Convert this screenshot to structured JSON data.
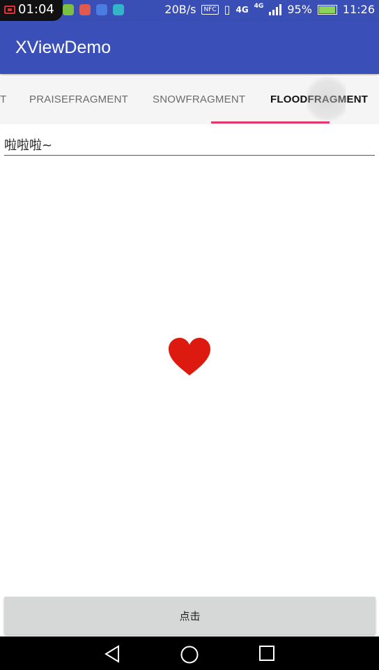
{
  "status_bar": {
    "recording_time": "01:04",
    "net_speed": "20B/s",
    "nfc": "NFC",
    "network": "4G",
    "network2": "4G",
    "battery": "95%",
    "clock": "11:26"
  },
  "app_bar": {
    "title": "XViewDemo"
  },
  "tabs": {
    "items": [
      {
        "label": "T"
      },
      {
        "label": "PRAISEFRAGMENT"
      },
      {
        "label": "SNOWFRAGMENT"
      },
      {
        "label": "FLOODFRAGMENT"
      }
    ],
    "active_index": 3
  },
  "input": {
    "value": "啦啦啦~"
  },
  "heart": {
    "icon": "heart-icon",
    "color": "#dd1a0f"
  },
  "button": {
    "label": "点击"
  },
  "nav_bar": {
    "back": "back-icon",
    "home": "home-icon",
    "recents": "recents-icon"
  },
  "colors": {
    "primary": "#3a50b8",
    "accent": "#e2376b"
  }
}
